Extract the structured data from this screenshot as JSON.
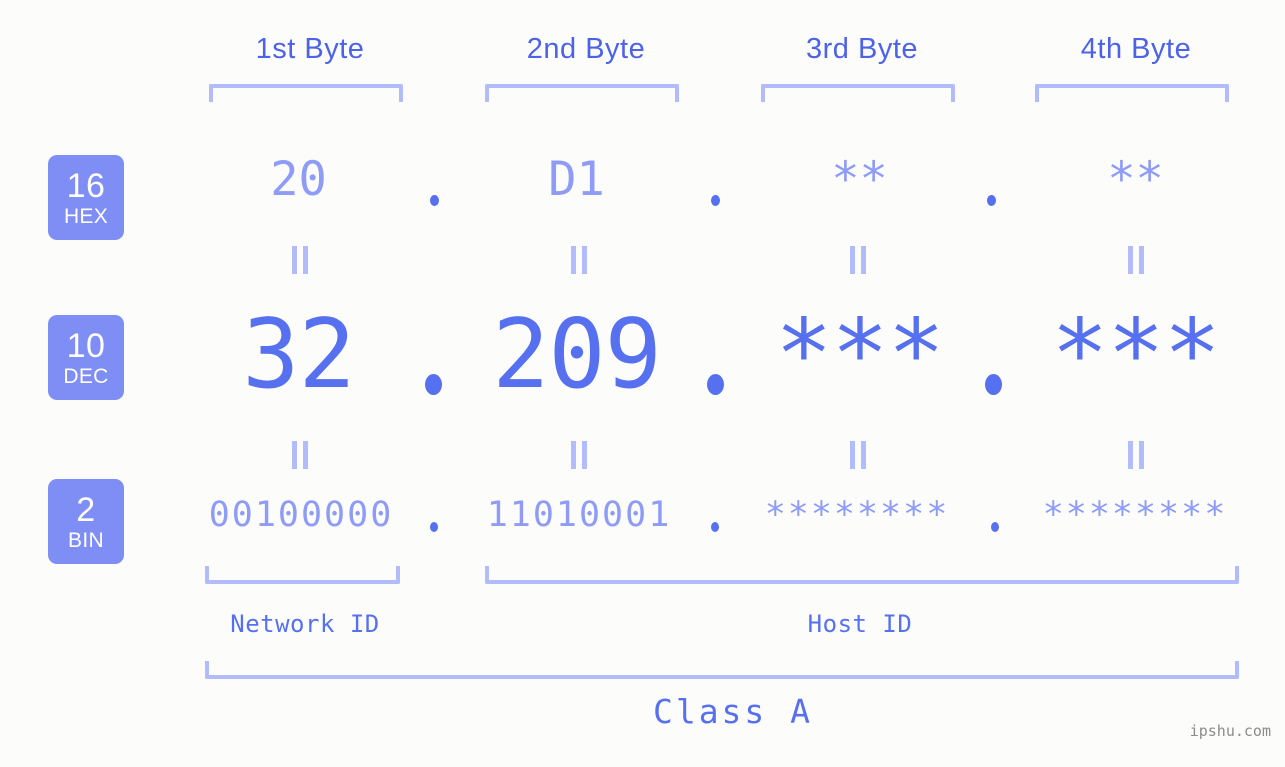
{
  "background_color": "#fcfdfa",
  "accent_color": "#5670ef",
  "accent_light_color": "#8e9cf7",
  "bracket_color": "#b3bcfa",
  "badge_color": "#7f8ef4",
  "header": {
    "bytes": [
      {
        "label": "1st Byte"
      },
      {
        "label": "2nd Byte"
      },
      {
        "label": "3rd Byte"
      },
      {
        "label": "4th Byte"
      }
    ]
  },
  "rows": [
    {
      "key": "hex",
      "badge_number": "16",
      "badge_system": "HEX",
      "values": [
        "20",
        "D1",
        "**",
        "**"
      ],
      "separator": "."
    },
    {
      "key": "dec",
      "badge_number": "10",
      "badge_system": "DEC",
      "values": [
        "32",
        "209",
        "***",
        "***"
      ],
      "separator": "."
    },
    {
      "key": "bin",
      "badge_number": "2",
      "badge_system": "BIN",
      "values": [
        "00100000",
        "11010001",
        "********",
        "********"
      ],
      "separator": "."
    }
  ],
  "equals_mark": "||",
  "footer": {
    "segments": [
      {
        "label": "Network ID"
      },
      {
        "label": "Host ID"
      }
    ],
    "class_label": "Class A",
    "watermark": "ipshu.com"
  }
}
